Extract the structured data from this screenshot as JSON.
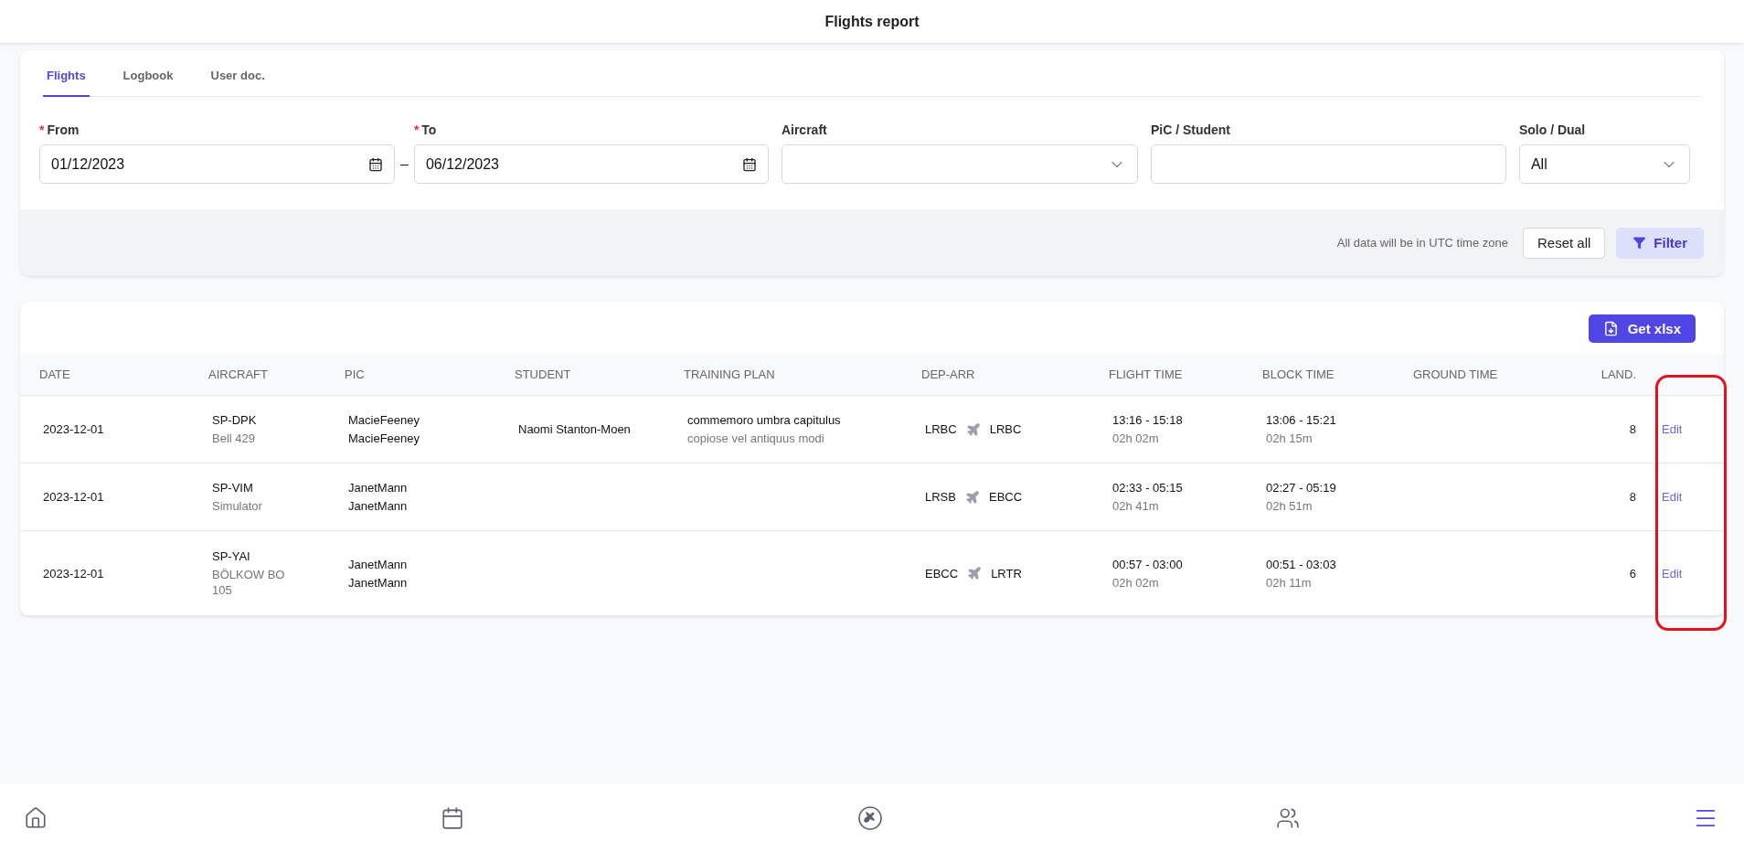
{
  "header": {
    "title": "Flights report"
  },
  "tabs": [
    {
      "label": "Flights",
      "selected": true
    },
    {
      "label": "Logbook",
      "selected": false
    },
    {
      "label": "User doc.",
      "selected": false
    }
  ],
  "filters": {
    "from": {
      "label": "From",
      "required_mark": "*",
      "value": "01/12/2023"
    },
    "separator": "–",
    "to": {
      "label": "To",
      "required_mark": "*",
      "value": "06/12/2023"
    },
    "aircraft": {
      "label": "Aircraft"
    },
    "pic_student": {
      "label": "PiC / Student"
    },
    "solo_dual": {
      "label": "Solo / Dual",
      "value": "All"
    }
  },
  "filter_footer": {
    "note": "All data will be in UTC time zone",
    "reset_button": "Reset all",
    "filter_button": "Filter"
  },
  "export_button": "Get xlsx",
  "table": {
    "columns": [
      "DATE",
      "AIRCRAFT",
      "PIC",
      "STUDENT",
      "TRAINING PLAN",
      "DEP-ARR",
      "FLIGHT TIME",
      "BLOCK TIME",
      "GROUND TIME",
      "LAND."
    ],
    "rows": [
      {
        "date": "2023-12-01",
        "registration": "SP-DPK",
        "type": "Bell 429",
        "pic": [
          "MacieFeeney",
          "MacieFeeney"
        ],
        "student": "Naomi Stanton-Moen",
        "plan": "commemoro umbra capitulus",
        "plan_sub": "copiose vel antiquus modi",
        "dep": "LRBC",
        "arr": "LRBC",
        "flight": "13:16 - 15:18",
        "flight_dur": "02h 02m",
        "block": "13:06 - 15:21",
        "block_dur": "02h 15m",
        "landings": "8",
        "action": "Edit"
      },
      {
        "date": "2023-12-01",
        "registration": "SP-VIM",
        "type": "Simulator",
        "pic": [
          "JanetMann",
          "JanetMann"
        ],
        "dep": "LRSB",
        "arr": "EBCC",
        "flight": "02:33 - 05:15",
        "flight_dur": "02h 41m",
        "block": "02:27 - 05:19",
        "block_dur": "02h 51m",
        "landings": "8",
        "action": "Edit"
      },
      {
        "date": "2023-12-01",
        "registration": "SP-YAI",
        "type": "BÖLKOW BO 105",
        "pic": [
          "JanetMann",
          "JanetMann"
        ],
        "dep": "EBCC",
        "arr": "LRTR",
        "flight": "00:57 - 03:00",
        "flight_dur": "02h 02m",
        "block": "00:51 - 03:03",
        "block_dur": "02h 11m",
        "landings": "6",
        "action": "Edit"
      }
    ]
  },
  "bottom_nav": [
    {
      "kind": "home",
      "selected": false
    },
    {
      "kind": "calendar",
      "selected": false
    },
    {
      "kind": "flights",
      "selected": false
    },
    {
      "kind": "people",
      "selected": false
    },
    {
      "kind": "menu",
      "selected": true
    }
  ]
}
